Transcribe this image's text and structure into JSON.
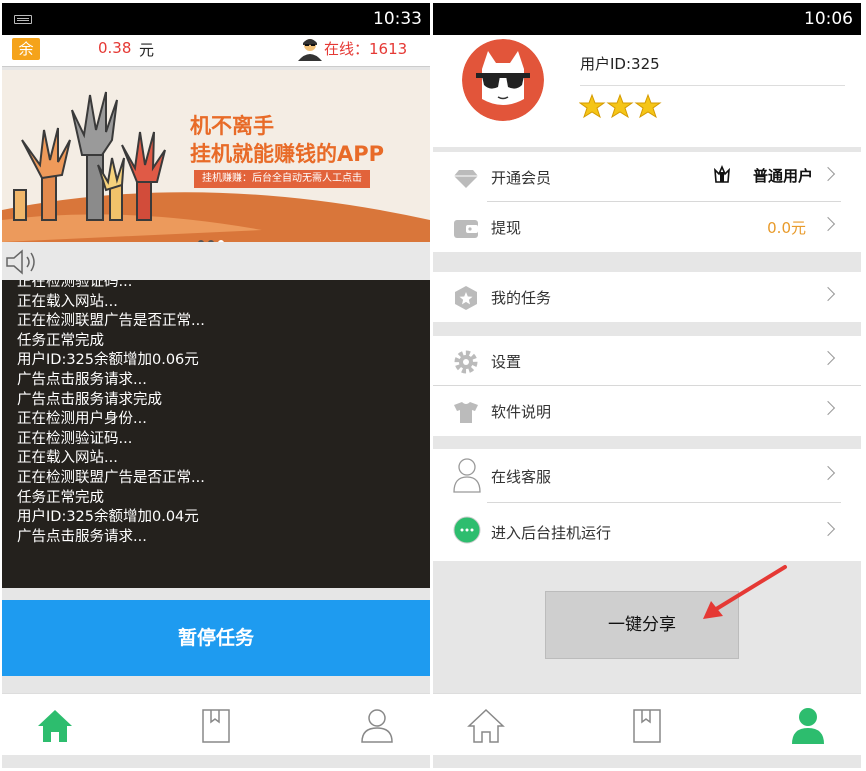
{
  "left": {
    "status_time": "10:33",
    "balance_icon": "余",
    "balance_value": "0.38",
    "balance_unit": "元",
    "online_label": "在线：1613",
    "banner": {
      "title": "机不离手",
      "subtitle": "挂机就能赚钱的APP",
      "tagline": "挂机赚赚：后台全自动无需人工点击"
    },
    "log_lines": [
      "正在检测验证码...",
      "正在载入网站...",
      "正在检测联盟广告是否正常...",
      "任务正常完成",
      "用户ID:325余额增加0.06元",
      "广告点击服务请求...",
      "广告点击服务请求完成",
      "正在检测用户身份...",
      "正在检测验证码...",
      "正在载入网站...",
      "正在检测联盟广告是否正常...",
      "任务正常完成",
      "用户ID:325余额增加0.04元",
      "广告点击服务请求..."
    ],
    "pause_button": "暂停任务",
    "tabs": [
      "home-icon",
      "book-icon",
      "user-icon"
    ],
    "active_tab": "home"
  },
  "right": {
    "status_time": "10:06",
    "user_id_label": "用户ID:325",
    "stars": 3,
    "menu": {
      "vip_label": "开通会员",
      "vip_value": "普通用户",
      "withdraw_label": "提现",
      "withdraw_value": "0.0元",
      "tasks_label": "我的任务",
      "settings_label": "设置",
      "manual_label": "软件说明",
      "service_label": "在线客服",
      "background_label": "进入后台挂机运行"
    },
    "share_button": "一键分享",
    "active_tab": "user"
  },
  "colors": {
    "accent_green": "#2dbd6e",
    "accent_blue": "#1e9bf0",
    "red": "#e53935",
    "orange": "#e86b28"
  }
}
